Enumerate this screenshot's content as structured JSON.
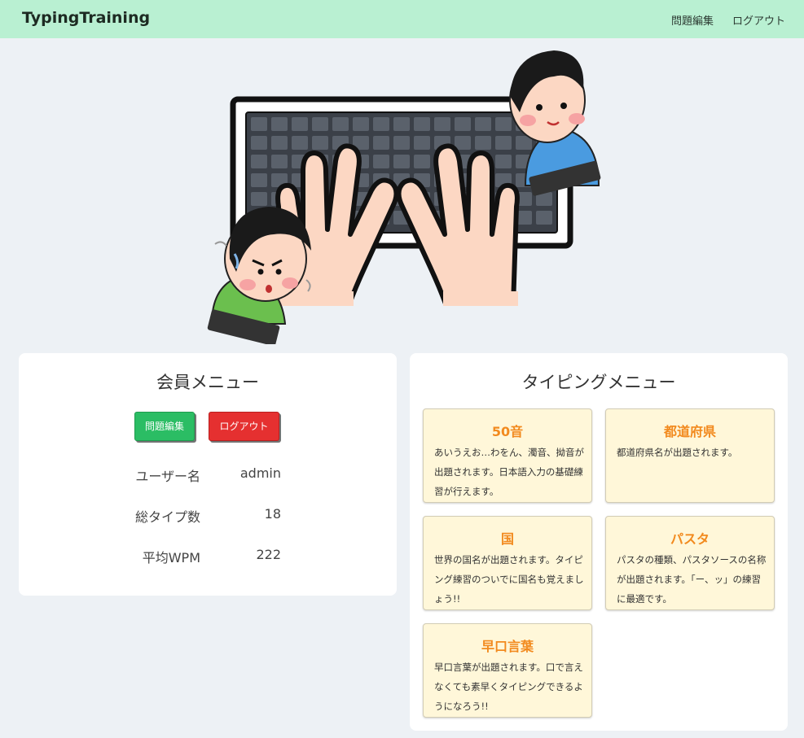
{
  "navbar": {
    "brand": "TypingTraining",
    "links": [
      "問題編集",
      "ログアウト"
    ]
  },
  "hero": {
    "image": "typing-hands-illustration"
  },
  "member_menu": {
    "title": "会員メニュー",
    "buttons": {
      "edit": "問題編集",
      "logout": "ログアウト"
    },
    "stats": [
      {
        "label": "ユーザー名",
        "value": "admin"
      },
      {
        "label": "総タイプ数",
        "value": "18"
      },
      {
        "label": "平均WPM",
        "value": "222"
      }
    ]
  },
  "typing_menu": {
    "title": "タイピングメニュー",
    "modes": [
      {
        "title": "50音",
        "desc": "あいうえお…わをん、濁音、拗音が出題されます。日本語入力の基礎練習が行えます。"
      },
      {
        "title": "都道府県",
        "desc": "都道府県名が出題されます。"
      },
      {
        "title": "国",
        "desc": "世界の国名が出題されます。タイピング練習のついでに国名も覚えましょう!!"
      },
      {
        "title": "パスタ",
        "desc": "パスタの種類、パスタソースの名称が出題されます。「ー、ッ」の練習に最適です。"
      },
      {
        "title": "早口言葉",
        "desc": "早口言葉が出題されます。口で言えなくても素早くタイピングできるようになろう!!"
      }
    ]
  },
  "colors": {
    "navbar": "#b9f0d2",
    "background": "#edf1f5",
    "accent_orange": "#f28a1e",
    "button_green": "#2bbd64",
    "button_red": "#e53030",
    "mode_card": "#fff7d9"
  }
}
